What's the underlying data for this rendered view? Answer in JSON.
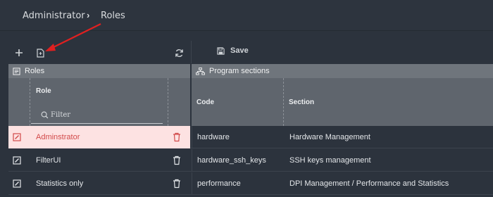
{
  "breadcrumb": {
    "parent": "Administrator",
    "current": "Roles"
  },
  "toolbar": {
    "save_label": "Save"
  },
  "panels": {
    "roles_title": "Roles",
    "sections_title": "Program sections"
  },
  "table": {
    "role_header": "Role",
    "filter_placeholder": "Filter",
    "code_header": "Code",
    "section_header": "Section",
    "rows": [
      {
        "role": "Adminstrator",
        "code": "hardware",
        "section": "Hardware Management",
        "selected": true
      },
      {
        "role": "FilterUI",
        "code": "hardware_ssh_keys",
        "section": "SSH keys management",
        "selected": false
      },
      {
        "role": "Statistics only",
        "code": "performance",
        "section": "DPI Management / Performance and Statistics",
        "selected": false
      }
    ]
  },
  "colors": {
    "background": "#2c333d",
    "selected_row": "#fde2e2",
    "selected_text": "#d24a4a",
    "annotation_arrow": "#e02020"
  },
  "icons": [
    "plus-icon",
    "file-icon",
    "refresh-icon",
    "save-icon",
    "roles-icon",
    "sitemap-icon",
    "search-icon",
    "edit-icon",
    "trash-icon"
  ]
}
